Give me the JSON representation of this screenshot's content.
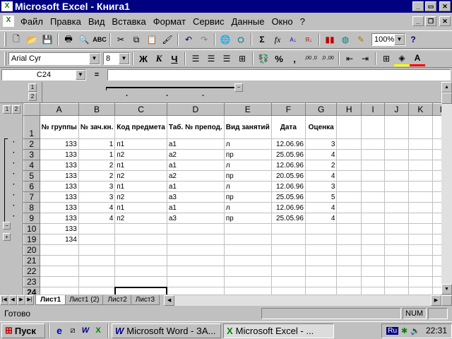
{
  "window": {
    "title": "Microsoft Excel - Книга1",
    "icon": "excel-icon"
  },
  "menu": [
    "Файл",
    "Правка",
    "Вид",
    "Вставка",
    "Формат",
    "Сервис",
    "Данные",
    "Окно",
    "?"
  ],
  "toolbar1": {
    "zoom": "100%",
    "icons": [
      "new-icon",
      "open-icon",
      "save-icon",
      "print-icon",
      "preview-icon",
      "spell-icon",
      "cut-icon",
      "copy-icon",
      "paste-icon",
      "format-painter-icon",
      "undo-icon",
      "redo-icon",
      "hyperlink-icon",
      "web-icon",
      "autosum-icon",
      "function-icon",
      "sort-asc-icon",
      "sort-desc-icon",
      "chart-icon",
      "map-icon",
      "drawing-icon",
      "help-icon"
    ]
  },
  "toolbar2": {
    "font": "Arial Cyr",
    "size": "8",
    "bold": "Ж",
    "italic": "К",
    "underline": "Ч",
    "percent": "%",
    "comma": ",",
    "dec_inc": ",00 ,0",
    "dec_dec": ",0 ,00"
  },
  "formula_bar": {
    "name_box": "C24",
    "equals": "=",
    "value": ""
  },
  "outline": {
    "levels": [
      "1",
      "2"
    ],
    "row_levels": [
      "1",
      "2"
    ]
  },
  "columns": [
    "A",
    "B",
    "C",
    "D",
    "E",
    "F",
    "G",
    "H",
    "I",
    "J",
    "K",
    "L"
  ],
  "header_row": {
    "row": "1",
    "cells": [
      "№ группы",
      "№ зач.кн.",
      "Код предмета",
      "Таб. № препод.",
      "Вид занятий",
      "Дата",
      "Оценка",
      "",
      "",
      "",
      "",
      ""
    ]
  },
  "rows": [
    {
      "row": "2",
      "cells": [
        "133",
        "1",
        "п1",
        "а1",
        "л",
        "12.06.96",
        "3"
      ]
    },
    {
      "row": "3",
      "cells": [
        "133",
        "1",
        "п2",
        "а2",
        "пр",
        "25.05.96",
        "4"
      ]
    },
    {
      "row": "4",
      "cells": [
        "133",
        "2",
        "п1",
        "а1",
        "л",
        "12.06.96",
        "2"
      ]
    },
    {
      "row": "5",
      "cells": [
        "133",
        "2",
        "п2",
        "а2",
        "пр",
        "20.05.96",
        "4"
      ]
    },
    {
      "row": "6",
      "cells": [
        "133",
        "3",
        "п1",
        "а1",
        "л",
        "12.06.96",
        "3"
      ]
    },
    {
      "row": "7",
      "cells": [
        "133",
        "3",
        "п2",
        "а3",
        "пр",
        "25.05.96",
        "5"
      ]
    },
    {
      "row": "8",
      "cells": [
        "133",
        "4",
        "п1",
        "а1",
        "л",
        "12.06.96",
        "4"
      ]
    },
    {
      "row": "9",
      "cells": [
        "133",
        "4",
        "п2",
        "а3",
        "пр",
        "25.05.96",
        "4"
      ]
    },
    {
      "row": "10",
      "cells": [
        "133",
        "",
        "",
        "",
        "",
        "",
        ""
      ]
    },
    {
      "row": "19",
      "cells": [
        "134",
        "",
        "",
        "",
        "",
        "",
        ""
      ]
    },
    {
      "row": "20",
      "cells": [
        "",
        "",
        "",
        "",
        "",
        "",
        ""
      ]
    },
    {
      "row": "21",
      "cells": [
        "",
        "",
        "",
        "",
        "",
        "",
        ""
      ]
    },
    {
      "row": "22",
      "cells": [
        "",
        "",
        "",
        "",
        "",
        "",
        ""
      ]
    },
    {
      "row": "23",
      "cells": [
        "",
        "",
        "",
        "",
        "",
        "",
        ""
      ]
    },
    {
      "row": "24",
      "cells": [
        "",
        "",
        "",
        "",
        "",
        "",
        ""
      ]
    }
  ],
  "sheets": [
    "Лист1",
    "Лист1 (2)",
    "Лист2",
    "Лист3"
  ],
  "status": {
    "text": "Готово",
    "num": "NUM"
  },
  "taskbar": {
    "start": "Пуск",
    "tasks": [
      "Microsoft Word - ЗА...",
      "Microsoft Excel - ..."
    ],
    "lang": "Ru",
    "time": "22:31"
  }
}
